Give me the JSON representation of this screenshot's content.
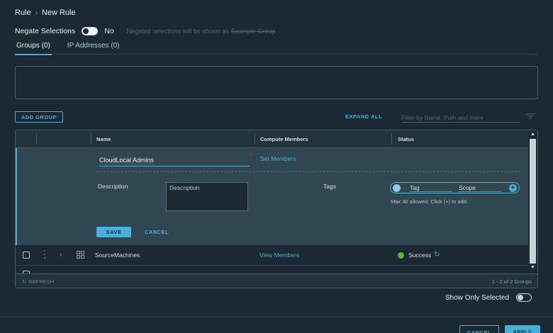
{
  "breadcrumb": {
    "root": "Rule",
    "separator": "›",
    "current": "New Rule"
  },
  "negate": {
    "label": "Negate Selections",
    "value": "No",
    "hint_prefix": "Negated selections will be shown as ",
    "hint_example": "Example Group"
  },
  "tabs": [
    {
      "label": "Groups (0)",
      "active": true
    },
    {
      "label": "IP Addresses (0)",
      "active": false
    }
  ],
  "toolbar": {
    "add_group": "ADD GROUP",
    "expand_all": "EXPAND ALL",
    "filter_placeholder": "Filter by Name, Path and more"
  },
  "grid": {
    "columns": {
      "name": "Name",
      "compute_members": "Compute Members",
      "status": "Status"
    },
    "editor": {
      "name_value": "CloudLocal Admins",
      "required_mark": "*",
      "set_members": "Set Members",
      "description_label": "Description",
      "description_placeholder": "Description",
      "tags_label": "Tags",
      "tag_placeholder": "Tag",
      "scope_placeholder": "Scope",
      "tags_hint": "Max 30 allowed. Click (+) to add.",
      "save": "SAVE",
      "cancel": "CANCEL"
    },
    "rows": [
      {
        "name": "SourceMachines",
        "members_link": "View Members",
        "status": "Success",
        "status_color": "#60b515"
      }
    ],
    "footer": {
      "refresh": "REFRESH",
      "count": "1 - 2 of 2 Groups"
    }
  },
  "show_only_selected": "Show Only Selected",
  "footer": {
    "cancel": "CANCEL",
    "apply": "APPLY"
  },
  "colors": {
    "accent": "#49afd9",
    "background": "#1b2a32",
    "editor_bg": "#304651",
    "success": "#60b515",
    "required": "#e12200"
  }
}
